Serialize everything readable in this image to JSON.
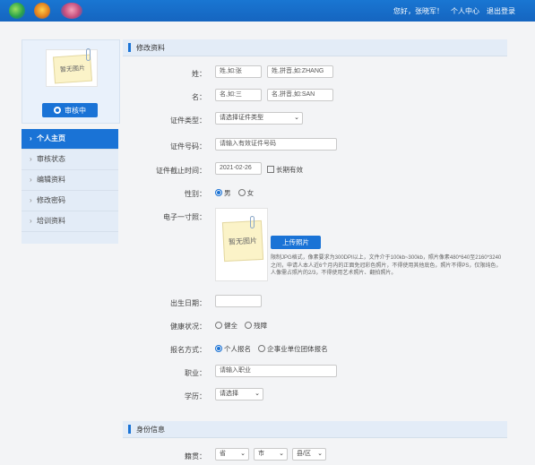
{
  "header": {
    "greeting": "您好，张晓军！",
    "links": [
      "个人中心",
      "退出登录"
    ]
  },
  "profile": {
    "photo_placeholder": "暂无图片",
    "status_button": "审核中"
  },
  "sidebar": {
    "items": [
      {
        "label": "个人主页",
        "active": true
      },
      {
        "label": "审核状态",
        "active": false
      },
      {
        "label": "编辑资料",
        "active": false
      },
      {
        "label": "修改密码",
        "active": false
      },
      {
        "label": "培训资料",
        "active": false
      }
    ]
  },
  "form": {
    "section_title": "修改资料",
    "surname": {
      "label": "姓：",
      "placeholder_cn": "姓,如:张",
      "placeholder_en": "姓,拼音,如:ZHANG"
    },
    "given": {
      "label": "名：",
      "placeholder_cn": "名,如:三",
      "placeholder_en": "名,拼音,如:SAN"
    },
    "id_type": {
      "label": "证件类型：",
      "value": "请选择证件类型"
    },
    "id_number": {
      "label": "证件号码：",
      "placeholder": "请输入有效证件号码"
    },
    "id_expiry": {
      "label": "证件截止时间：",
      "value": "2021-02-26",
      "long_term": "长期有效"
    },
    "gender": {
      "label": "性别：",
      "options": [
        "男",
        "女"
      ],
      "selected": "男"
    },
    "photo": {
      "label": "电子一寸照：",
      "placeholder": "暂无图片",
      "upload_button": "上传照片",
      "description": "限制JPG格式，像素要求为300DPI以上，文件介于100kb~300kb，照片像素480*640至2160*3240之间，申请人本人近6个月内的正面免冠彩色照片，不得使用其他底色，照片不得PS，仅限纯色，人像需占照片的2/3，不得使用艺术照片、翻拍照片。"
    },
    "birth_date": {
      "label": "出生日期：",
      "value": ""
    },
    "health": {
      "label": "健康状况：",
      "options": [
        "健全",
        "残障"
      ]
    },
    "registration": {
      "label": "报名方式：",
      "options": [
        "个人报名",
        "企事业单位团体报名"
      ],
      "selected": "个人报名"
    },
    "occupation": {
      "label": "职业：",
      "placeholder": "请输入职业"
    },
    "education": {
      "label": "学历：",
      "value": "请选择"
    }
  },
  "identity": {
    "section_title": "身份信息",
    "origin": {
      "label": "籍贯：",
      "province": "省",
      "city": "市",
      "district": "县/区"
    }
  },
  "colors": {
    "primary": "#1a73d6",
    "header": "#1565c0",
    "panel": "#e3ecf7"
  }
}
